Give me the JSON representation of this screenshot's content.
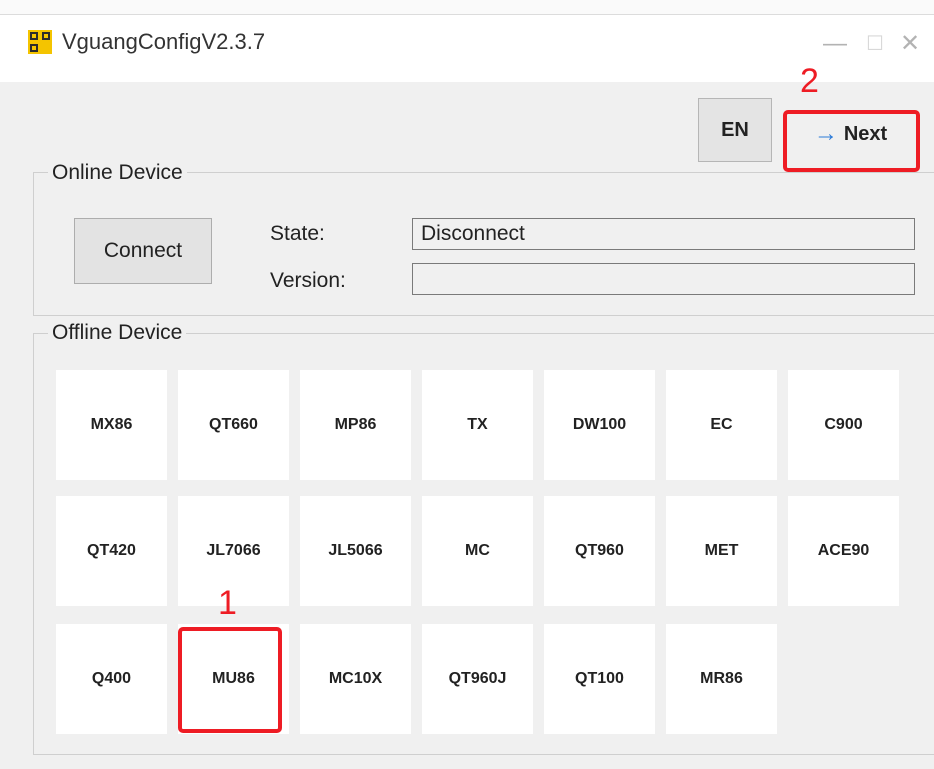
{
  "window": {
    "title": "VguangConfigV2.3.7",
    "controls": {
      "minimize": "—",
      "maximize": "☐",
      "close": "✕"
    }
  },
  "toolbar": {
    "language_label": "EN",
    "next_label": "Next",
    "next_arrow": "→"
  },
  "annotations": {
    "step1": "1",
    "step2": "2",
    "color": "#ee1c24"
  },
  "online": {
    "title": "Online Device",
    "connect_label": "Connect",
    "state_label": "State:",
    "state_value": "Disconnect",
    "version_label": "Version:",
    "version_value": ""
  },
  "offline": {
    "title": "Offline Device",
    "devices": [
      "MX86",
      "QT660",
      "MP86",
      "TX",
      "DW100",
      "EC",
      "C900",
      "QT420",
      "JL7066",
      "JL5066",
      "MC",
      "QT960",
      "MET",
      "ACE90",
      "Q400",
      "MU86",
      "MC10X",
      "QT960J",
      "QT100",
      "MR86"
    ]
  }
}
